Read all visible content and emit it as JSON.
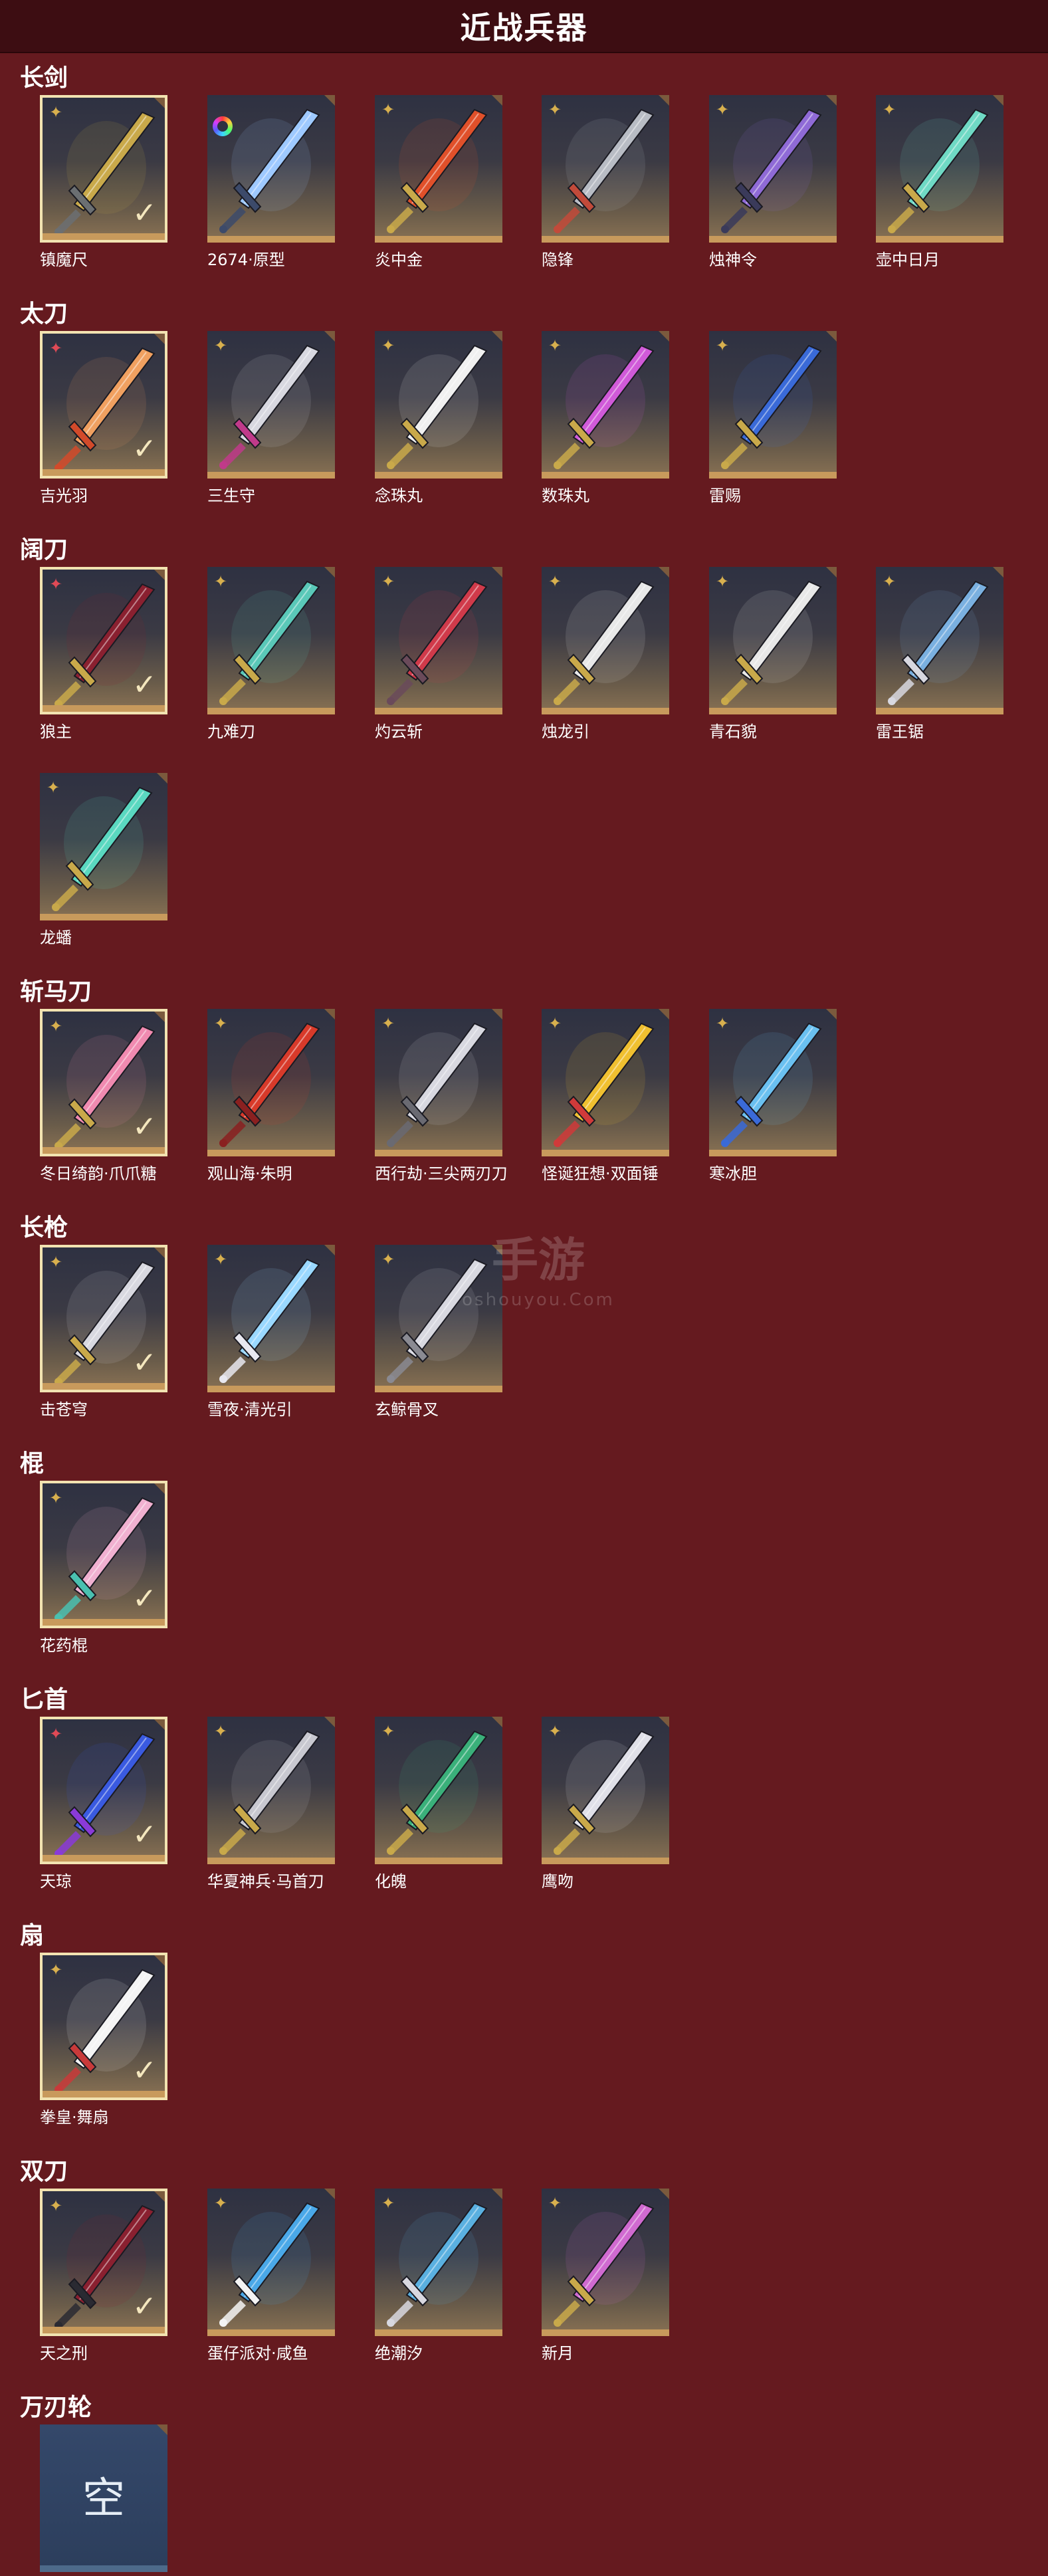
{
  "header": {
    "title": "近战兵器"
  },
  "watermark": {
    "brand": "手游",
    "site": "oshouyou.Com"
  },
  "categories": [
    {
      "title": "长剑",
      "items": [
        {
          "name": "镇魔尺",
          "owned": true,
          "badge": "gold-star",
          "colors": [
            "#c9a94a",
            "#6b6f72"
          ]
        },
        {
          "name": "2674·原型",
          "owned": false,
          "badge": "rainbow",
          "colors": [
            "#9ec9ff",
            "#3c4a6a"
          ]
        },
        {
          "name": "炎中金",
          "owned": false,
          "badge": "gold-star",
          "colors": [
            "#e0502a",
            "#c9a94a"
          ]
        },
        {
          "name": "隐锋",
          "owned": false,
          "badge": "gold-star",
          "colors": [
            "#b8bcc4",
            "#c24a3a"
          ]
        },
        {
          "name": "烛神令",
          "owned": false,
          "badge": "gold-star",
          "colors": [
            "#8f6ad6",
            "#3a3a5a"
          ]
        },
        {
          "name": "壶中日月",
          "owned": false,
          "badge": "gold-star",
          "colors": [
            "#6fd9c4",
            "#c9a94a"
          ]
        }
      ]
    },
    {
      "title": "太刀",
      "items": [
        {
          "name": "吉光羽",
          "owned": true,
          "badge": "red-star",
          "colors": [
            "#f0a060",
            "#d24a2a"
          ]
        },
        {
          "name": "三生守",
          "owned": false,
          "badge": "gold-star",
          "colors": [
            "#d8d8e0",
            "#c03a8a"
          ]
        },
        {
          "name": "念珠丸",
          "owned": false,
          "badge": "gold-star",
          "colors": [
            "#f0f0f0",
            "#c9a94a"
          ]
        },
        {
          "name": "数珠丸",
          "owned": false,
          "badge": "gold-star",
          "colors": [
            "#d05ad8",
            "#c9a94a"
          ]
        },
        {
          "name": "雷赐",
          "owned": false,
          "badge": "gold-star",
          "colors": [
            "#3a6ad8",
            "#c9a94a"
          ]
        }
      ]
    },
    {
      "title": "阔刀",
      "items": [
        {
          "name": "狼主",
          "owned": true,
          "badge": "red-star",
          "colors": [
            "#8a2030",
            "#c9a94a"
          ]
        },
        {
          "name": "九难刀",
          "owned": false,
          "badge": "gold-star",
          "colors": [
            "#5ac8b8",
            "#c9a94a"
          ]
        },
        {
          "name": "灼云斩",
          "owned": false,
          "badge": "gold-star",
          "colors": [
            "#d03a4a",
            "#6a4a5a"
          ]
        },
        {
          "name": "烛龙引",
          "owned": false,
          "badge": "gold-star",
          "colors": [
            "#e8e8e8",
            "#c9a94a"
          ]
        },
        {
          "name": "青石貌",
          "owned": false,
          "badge": "gold-star",
          "colors": [
            "#e8e8e8",
            "#c9a94a"
          ]
        },
        {
          "name": "雷王锯",
          "owned": false,
          "badge": "gold-star",
          "colors": [
            "#7ab0e0",
            "#d8d8e0"
          ]
        },
        {
          "name": "龙蟠",
          "owned": false,
          "badge": "gold-star",
          "colors": [
            "#5ad8c0",
            "#c9a94a"
          ]
        }
      ]
    },
    {
      "title": "斩马刀",
      "items": [
        {
          "name": "冬日绮韵·爪爪糖",
          "owned": true,
          "badge": "gold-star",
          "colors": [
            "#f08ab0",
            "#c9a94a"
          ]
        },
        {
          "name": "观山海·朱明",
          "owned": false,
          "badge": "gold-star",
          "colors": [
            "#d83a2a",
            "#8a2020"
          ]
        },
        {
          "name": "西行劫·三尖两刃刀",
          "owned": false,
          "badge": "gold-star",
          "colors": [
            "#d8d8e0",
            "#6a6a72"
          ]
        },
        {
          "name": "怪诞狂想·双面锤",
          "owned": false,
          "badge": "gold-star",
          "colors": [
            "#f0c030",
            "#d03a3a"
          ]
        },
        {
          "name": "寒冰胆",
          "owned": false,
          "badge": "gold-star",
          "colors": [
            "#6ac0f0",
            "#3a6ad8"
          ]
        }
      ]
    },
    {
      "title": "长枪",
      "items": [
        {
          "name": "击苍穹",
          "owned": true,
          "badge": "gold-star",
          "colors": [
            "#d8d8e0",
            "#c9a94a"
          ]
        },
        {
          "name": "雪夜·清光引",
          "owned": false,
          "badge": "gold-star",
          "colors": [
            "#9ad8ff",
            "#e8e8f0"
          ]
        },
        {
          "name": "玄鲸骨叉",
          "owned": false,
          "badge": "gold-star",
          "colors": [
            "#d8d8e0",
            "#8a8a92"
          ]
        }
      ]
    },
    {
      "title": "棍",
      "items": [
        {
          "name": "花药棍",
          "owned": true,
          "badge": "gold-star",
          "colors": [
            "#f0b0d0",
            "#4ac0b0"
          ]
        }
      ]
    },
    {
      "title": "匕首",
      "items": [
        {
          "name": "天琼",
          "owned": true,
          "badge": "red-star",
          "colors": [
            "#3a5ae0",
            "#8a3ad8"
          ]
        },
        {
          "name": "华夏神兵·马首刀",
          "owned": false,
          "badge": "gold-star",
          "colors": [
            "#c8c8d0",
            "#c9a94a"
          ]
        },
        {
          "name": "化魄",
          "owned": false,
          "badge": "gold-star",
          "colors": [
            "#3ab07a",
            "#c9a94a"
          ]
        },
        {
          "name": "鹰吻",
          "owned": false,
          "badge": "gold-star",
          "colors": [
            "#e0e0e8",
            "#c9a94a"
          ]
        }
      ]
    },
    {
      "title": "扇",
      "items": [
        {
          "name": "拳皇·舞扇",
          "owned": true,
          "badge": "gold-star",
          "colors": [
            "#f4f4f4",
            "#c83a3a"
          ]
        }
      ]
    },
    {
      "title": "双刀",
      "items": [
        {
          "name": "天之刑",
          "owned": true,
          "badge": "gold-star",
          "colors": [
            "#8a2030",
            "#2a2a32"
          ]
        },
        {
          "name": "蛋仔派对·咸鱼",
          "owned": false,
          "badge": "gold-star",
          "colors": [
            "#4aa8e8",
            "#f4f4f4"
          ]
        },
        {
          "name": "绝潮汐",
          "owned": false,
          "badge": "gold-star",
          "colors": [
            "#5ab0e0",
            "#d8d8e0"
          ]
        },
        {
          "name": "新月",
          "owned": false,
          "badge": "gold-star",
          "colors": [
            "#d06ad0",
            "#c9a94a"
          ]
        }
      ]
    },
    {
      "title": "万刃轮",
      "items": [
        {
          "name": "",
          "owned": false,
          "badge": "none",
          "empty_label": "空",
          "colors": [
            "#e6eef6",
            "#34486a"
          ]
        }
      ]
    }
  ]
}
